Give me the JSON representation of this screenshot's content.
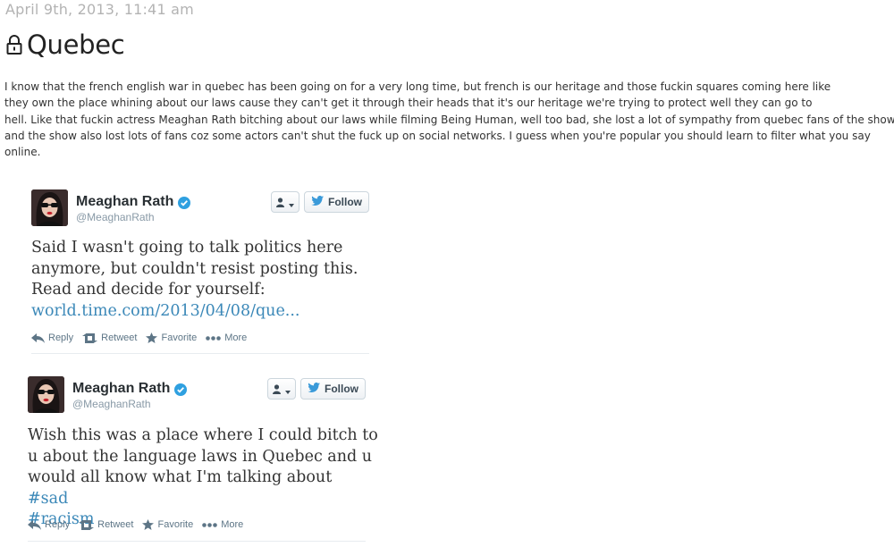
{
  "post": {
    "date": "April 9th, 2013, 11:41 am",
    "title": "Quebec",
    "body_lines": [
      "I know that the french english war in quebec has been going on for a very long time, but french is our heritage and those fuckin squares coming here like",
      "they own the place whining about our laws cause they can't get it through their heads that it's our heritage we're trying to protect well they can go to",
      "hell. Like that fuckin actress Meaghan Rath bitching about our laws while filming Being Human, well too bad, she lost a lot of sympathy from quebec fans of the show",
      "and the show also lost lots of fans coz some actors can't shut the fuck up on social networks. I guess when you're popular you should learn to filter what you say",
      "online."
    ]
  },
  "tweets": [
    {
      "name": "Meaghan Rath",
      "handle": "@MeaghanRath",
      "follow_label": "Follow",
      "lines": [
        "Said I wasn't going to talk politics here",
        "anymore, but couldn't resist posting this.",
        "Read and decide for yourself:"
      ],
      "link": "world.time.com/2013/04/08/que...",
      "actions": {
        "reply": "Reply",
        "retweet": "Retweet",
        "favorite": "Favorite",
        "more": "More"
      }
    },
    {
      "name": "Meaghan Rath",
      "handle": "@MeaghanRath",
      "follow_label": "Follow",
      "lines": [
        "Wish this was a place where I could bitch to",
        "u about the language laws in Quebec and u"
      ],
      "line3_text": "would all know what I'm talking about ",
      "hashtag1": "#sad",
      "hashtag2": "#racism",
      "actions": {
        "reply": "Reply",
        "retweet": "Retweet",
        "favorite": "Favorite",
        "more": "More"
      }
    }
  ],
  "colors": {
    "link": "#3b88b8",
    "verified_badge": "#2fa0e0",
    "twitter_bird": "#3a9ad9",
    "action_text": "#5d7586"
  },
  "icons": [
    "lock-icon",
    "verified-badge-icon",
    "person-icon",
    "twitter-bird-icon",
    "reply-icon",
    "retweet-icon",
    "favorite-star-icon",
    "more-dots-icon"
  ]
}
